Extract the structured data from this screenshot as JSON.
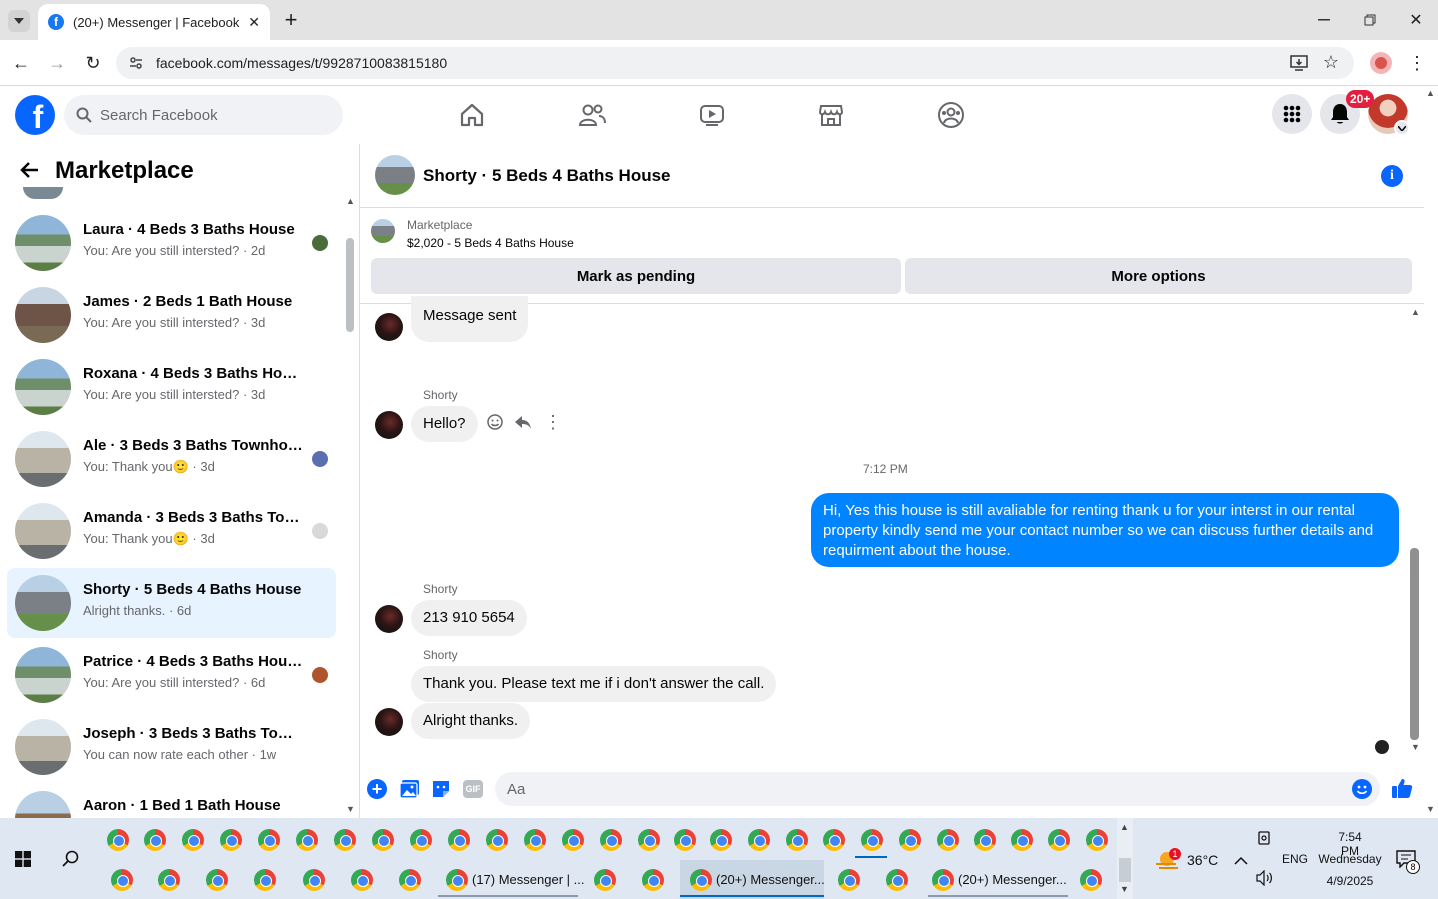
{
  "browser": {
    "tab_title": "(20+) Messenger | Facebook",
    "url": "facebook.com/messages/t/9928710083815180"
  },
  "fb": {
    "search_placeholder": "Search Facebook",
    "notification_badge": "20+"
  },
  "sidebar": {
    "title": "Marketplace",
    "conversations": [
      {
        "name": "Laura · 4 Beds 3 Baths House",
        "preview": "You: Are you still intersted? · 2d"
      },
      {
        "name": "James · 2 Beds 1 Bath House",
        "preview": "You: Are you still intersted? · 3d"
      },
      {
        "name": "Roxana · 4 Beds 3 Baths House",
        "preview": "You: Are you still intersted? · 3d"
      },
      {
        "name": "Ale · 3 Beds 3 Baths Townhouse",
        "preview": "You: Thank you🙂 · 3d"
      },
      {
        "name": "Amanda · 3 Beds 3 Baths Tow...",
        "preview": "You: Thank you🙂 · 3d"
      },
      {
        "name": "Shorty · 5 Beds 4 Baths House",
        "preview": "Alright thanks. · 6d"
      },
      {
        "name": "Patrice · 4 Beds 3 Baths House",
        "preview": "You: Are you still intersted? · 6d"
      },
      {
        "name": "Joseph · 3 Beds 3 Baths Townho...",
        "preview": "You can now rate each other · 1w"
      },
      {
        "name": "Aaron · 1 Bed 1 Bath House",
        "preview": ""
      }
    ]
  },
  "chat": {
    "title": "Shorty · 5 Beds 4 Baths House",
    "listing_label": "Marketplace",
    "listing_price": "$2,020 - 5 Beds 4 Baths House",
    "mark_pending": "Mark as pending",
    "more_options": "More options",
    "messages": {
      "m1": "Message sent",
      "sender": "Shorty",
      "m2": "Hello?",
      "time": "7:12 PM",
      "mine": "Hi, Yes this house is still avaliable for renting thank u for your interst in our rental property kindly send me your contact number so we can discuss further details and requirment about the house.",
      "m3": "213 910 5654",
      "m4": "Thank you. Please text me if i don't answer the call.",
      "m5": "Alright thanks."
    },
    "composer_placeholder": "Aa",
    "gif_label": "GIF"
  },
  "taskbar": {
    "window1": "(17) Messenger | ...",
    "window2": "(20+) Messenger...",
    "window3": "(20+) Messenger...",
    "weather_badge": "1",
    "temp": "36°C",
    "lang": "ENG",
    "time": "7:54 PM",
    "day": "Wednesday",
    "date": "4/9/2025",
    "notif_count": "8"
  }
}
